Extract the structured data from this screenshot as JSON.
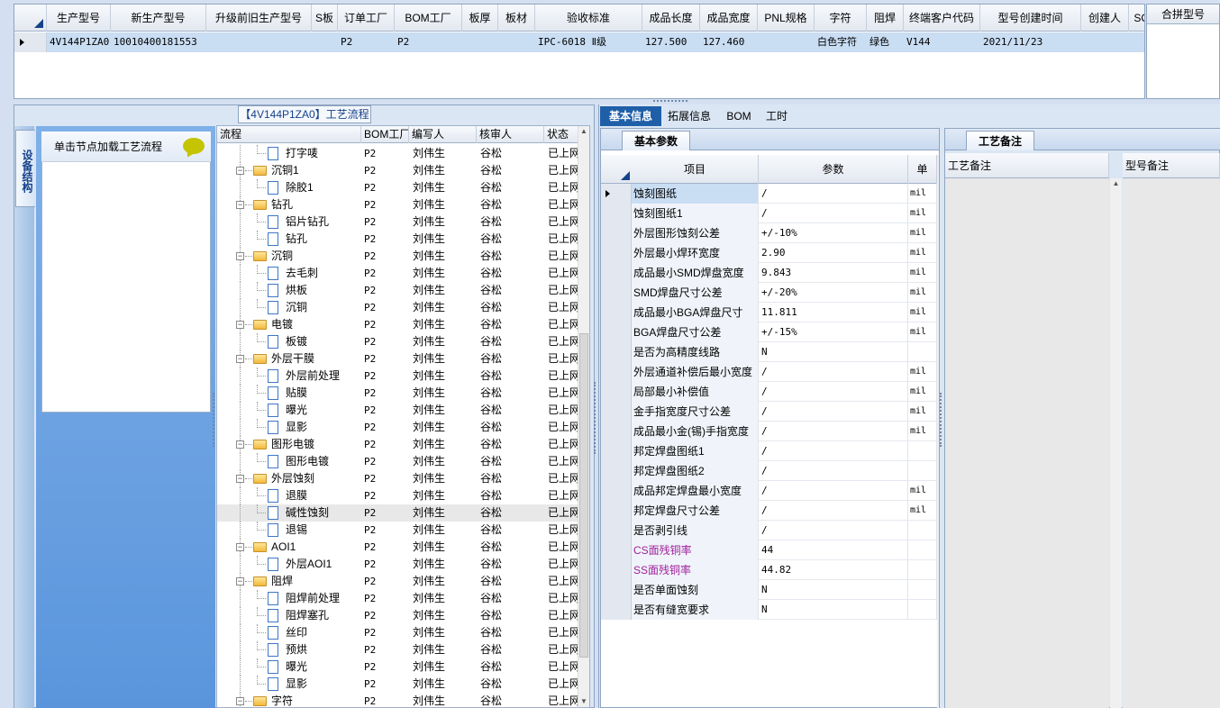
{
  "top_grid": {
    "columns": [
      "生产型号",
      "新生产型号",
      "升级前旧生产型号",
      "S板",
      "订单工厂",
      "BOM工厂",
      "板厚",
      "板材",
      "验收标准",
      "成品长度",
      "成品宽度",
      "PNL规格",
      "字符",
      "阻焊",
      "终端客户代码",
      "型号创建时间",
      "创建人",
      "SO"
    ],
    "row": [
      "4V144P1ZA0",
      "10010400181553",
      "",
      "",
      "P2",
      "P2",
      "",
      "",
      "IPC-6018 Ⅱ级",
      "127.500",
      "127.460",
      "",
      "白色字符",
      "绿色",
      "V144",
      "2021/11/23",
      "",
      ""
    ]
  },
  "merge_box": {
    "title": "合拼型号"
  },
  "left": {
    "vertical_tab": "设备结构",
    "node_hint": "单击节点加载工艺流程",
    "flow_title": "【4V144P1ZA0】工艺流程",
    "tree_columns": [
      "流程",
      "BOM工厂",
      "编写人",
      "核审人",
      "状态"
    ],
    "tree_rows": [
      {
        "name": "打字唛",
        "level": 2,
        "factory": "P2",
        "writer": "刘伟生",
        "reviewer": "谷松",
        "status": "已上网"
      },
      {
        "name": "沉铜1",
        "level": 1,
        "factory": "P2",
        "writer": "刘伟生",
        "reviewer": "谷松",
        "status": "已上网"
      },
      {
        "name": "除胶1",
        "level": 2,
        "factory": "P2",
        "writer": "刘伟生",
        "reviewer": "谷松",
        "status": "已上网"
      },
      {
        "name": "钻孔",
        "level": 1,
        "factory": "P2",
        "writer": "刘伟生",
        "reviewer": "谷松",
        "status": "已上网"
      },
      {
        "name": "铝片钻孔",
        "level": 2,
        "factory": "P2",
        "writer": "刘伟生",
        "reviewer": "谷松",
        "status": "已上网"
      },
      {
        "name": "钻孔",
        "level": 2,
        "factory": "P2",
        "writer": "刘伟生",
        "reviewer": "谷松",
        "status": "已上网"
      },
      {
        "name": "沉铜",
        "level": 1,
        "factory": "P2",
        "writer": "刘伟生",
        "reviewer": "谷松",
        "status": "已上网"
      },
      {
        "name": "去毛刺",
        "level": 2,
        "factory": "P2",
        "writer": "刘伟生",
        "reviewer": "谷松",
        "status": "已上网"
      },
      {
        "name": "烘板",
        "level": 2,
        "factory": "P2",
        "writer": "刘伟生",
        "reviewer": "谷松",
        "status": "已上网"
      },
      {
        "name": "沉铜",
        "level": 2,
        "factory": "P2",
        "writer": "刘伟生",
        "reviewer": "谷松",
        "status": "已上网"
      },
      {
        "name": "电镀",
        "level": 1,
        "factory": "P2",
        "writer": "刘伟生",
        "reviewer": "谷松",
        "status": "已上网"
      },
      {
        "name": "板镀",
        "level": 2,
        "factory": "P2",
        "writer": "刘伟生",
        "reviewer": "谷松",
        "status": "已上网"
      },
      {
        "name": "外层干膜",
        "level": 1,
        "factory": "P2",
        "writer": "刘伟生",
        "reviewer": "谷松",
        "status": "已上网"
      },
      {
        "name": "外层前处理",
        "level": 2,
        "factory": "P2",
        "writer": "刘伟生",
        "reviewer": "谷松",
        "status": "已上网"
      },
      {
        "name": "贴膜",
        "level": 2,
        "factory": "P2",
        "writer": "刘伟生",
        "reviewer": "谷松",
        "status": "已上网"
      },
      {
        "name": "曝光",
        "level": 2,
        "factory": "P2",
        "writer": "刘伟生",
        "reviewer": "谷松",
        "status": "已上网"
      },
      {
        "name": "显影",
        "level": 2,
        "factory": "P2",
        "writer": "刘伟生",
        "reviewer": "谷松",
        "status": "已上网"
      },
      {
        "name": "图形电镀",
        "level": 1,
        "factory": "P2",
        "writer": "刘伟生",
        "reviewer": "谷松",
        "status": "已上网"
      },
      {
        "name": "图形电镀",
        "level": 2,
        "factory": "P2",
        "writer": "刘伟生",
        "reviewer": "谷松",
        "status": "已上网"
      },
      {
        "name": "外层蚀刻",
        "level": 1,
        "factory": "P2",
        "writer": "刘伟生",
        "reviewer": "谷松",
        "status": "已上网"
      },
      {
        "name": "退膜",
        "level": 2,
        "factory": "P2",
        "writer": "刘伟生",
        "reviewer": "谷松",
        "status": "已上网"
      },
      {
        "name": "碱性蚀刻",
        "level": 2,
        "factory": "P2",
        "writer": "刘伟生",
        "reviewer": "谷松",
        "status": "已上网",
        "selected": true
      },
      {
        "name": "退锡",
        "level": 2,
        "factory": "P2",
        "writer": "刘伟生",
        "reviewer": "谷松",
        "status": "已上网"
      },
      {
        "name": "AOI1",
        "level": 1,
        "factory": "P2",
        "writer": "刘伟生",
        "reviewer": "谷松",
        "status": "已上网"
      },
      {
        "name": "外层AOI1",
        "level": 2,
        "factory": "P2",
        "writer": "刘伟生",
        "reviewer": "谷松",
        "status": "已上网"
      },
      {
        "name": "阻焊",
        "level": 1,
        "factory": "P2",
        "writer": "刘伟生",
        "reviewer": "谷松",
        "status": "已上网"
      },
      {
        "name": "阻焊前处理",
        "level": 2,
        "factory": "P2",
        "writer": "刘伟生",
        "reviewer": "谷松",
        "status": "已上网"
      },
      {
        "name": "阻焊塞孔",
        "level": 2,
        "factory": "P2",
        "writer": "刘伟生",
        "reviewer": "谷松",
        "status": "已上网"
      },
      {
        "name": "丝印",
        "level": 2,
        "factory": "P2",
        "writer": "刘伟生",
        "reviewer": "谷松",
        "status": "已上网"
      },
      {
        "name": "预烘",
        "level": 2,
        "factory": "P2",
        "writer": "刘伟生",
        "reviewer": "谷松",
        "status": "已上网"
      },
      {
        "name": "曝光",
        "level": 2,
        "factory": "P2",
        "writer": "刘伟生",
        "reviewer": "谷松",
        "status": "已上网"
      },
      {
        "name": "显影",
        "level": 2,
        "factory": "P2",
        "writer": "刘伟生",
        "reviewer": "谷松",
        "status": "已上网"
      },
      {
        "name": "字符",
        "level": 1,
        "factory": "P2",
        "writer": "刘伟生",
        "reviewer": "谷松",
        "status": "已上网"
      }
    ]
  },
  "right": {
    "tabs": [
      "基本信息",
      "拓展信息",
      "BOM",
      "工时"
    ],
    "active_tab": "基本信息",
    "param_tab": "基本参数",
    "param_columns": [
      "项目",
      "参数",
      "单"
    ],
    "params": [
      {
        "item": "蚀刻图纸",
        "value": "/",
        "unit": "mil",
        "selected": true
      },
      {
        "item": "蚀刻图纸1",
        "value": "/",
        "unit": "mil"
      },
      {
        "item": "外层图形蚀刻公差",
        "value": "+/-10%",
        "unit": "mil"
      },
      {
        "item": "外层最小焊环宽度",
        "value": "2.90",
        "unit": "mil"
      },
      {
        "item": "成品最小SMD焊盘宽度",
        "value": "9.843",
        "unit": "mil"
      },
      {
        "item": "SMD焊盘尺寸公差",
        "value": "+/-20%",
        "unit": "mil"
      },
      {
        "item": "成品最小BGA焊盘尺寸",
        "value": "11.811",
        "unit": "mil"
      },
      {
        "item": "BGA焊盘尺寸公差",
        "value": "+/-15%",
        "unit": "mil"
      },
      {
        "item": "是否为高精度线路",
        "value": "N",
        "unit": ""
      },
      {
        "item": "外层通道补偿后最小宽度",
        "value": "/",
        "unit": "mil"
      },
      {
        "item": "局部最小补偿值",
        "value": "/",
        "unit": "mil"
      },
      {
        "item": "金手指宽度尺寸公差",
        "value": "/",
        "unit": "mil"
      },
      {
        "item": "成品最小金(锡)手指宽度",
        "value": "/",
        "unit": "mil"
      },
      {
        "item": "邦定焊盘图纸1",
        "value": "/",
        "unit": ""
      },
      {
        "item": "邦定焊盘图纸2",
        "value": "/",
        "unit": ""
      },
      {
        "item": "成品邦定焊盘最小宽度",
        "value": "/",
        "unit": "mil"
      },
      {
        "item": "邦定焊盘尺寸公差",
        "value": "/",
        "unit": "mil"
      },
      {
        "item": "是否剥引线",
        "value": "/",
        "unit": ""
      },
      {
        "item": "CS面残铜率",
        "value": "44",
        "unit": "",
        "highlight": true
      },
      {
        "item": "SS面残铜率",
        "value": "44.82",
        "unit": "",
        "highlight": true
      },
      {
        "item": "是否单面蚀刻",
        "value": "N",
        "unit": ""
      },
      {
        "item": "是否有缝宽要求",
        "value": "N",
        "unit": ""
      }
    ],
    "notes_tab": "工艺备注",
    "notes_columns": [
      "工艺备注",
      "型号备注"
    ]
  },
  "colors": {
    "accent": "#1f5fa8",
    "highlight_text": "#a0209c",
    "selected_row": "#c9ddf3"
  }
}
